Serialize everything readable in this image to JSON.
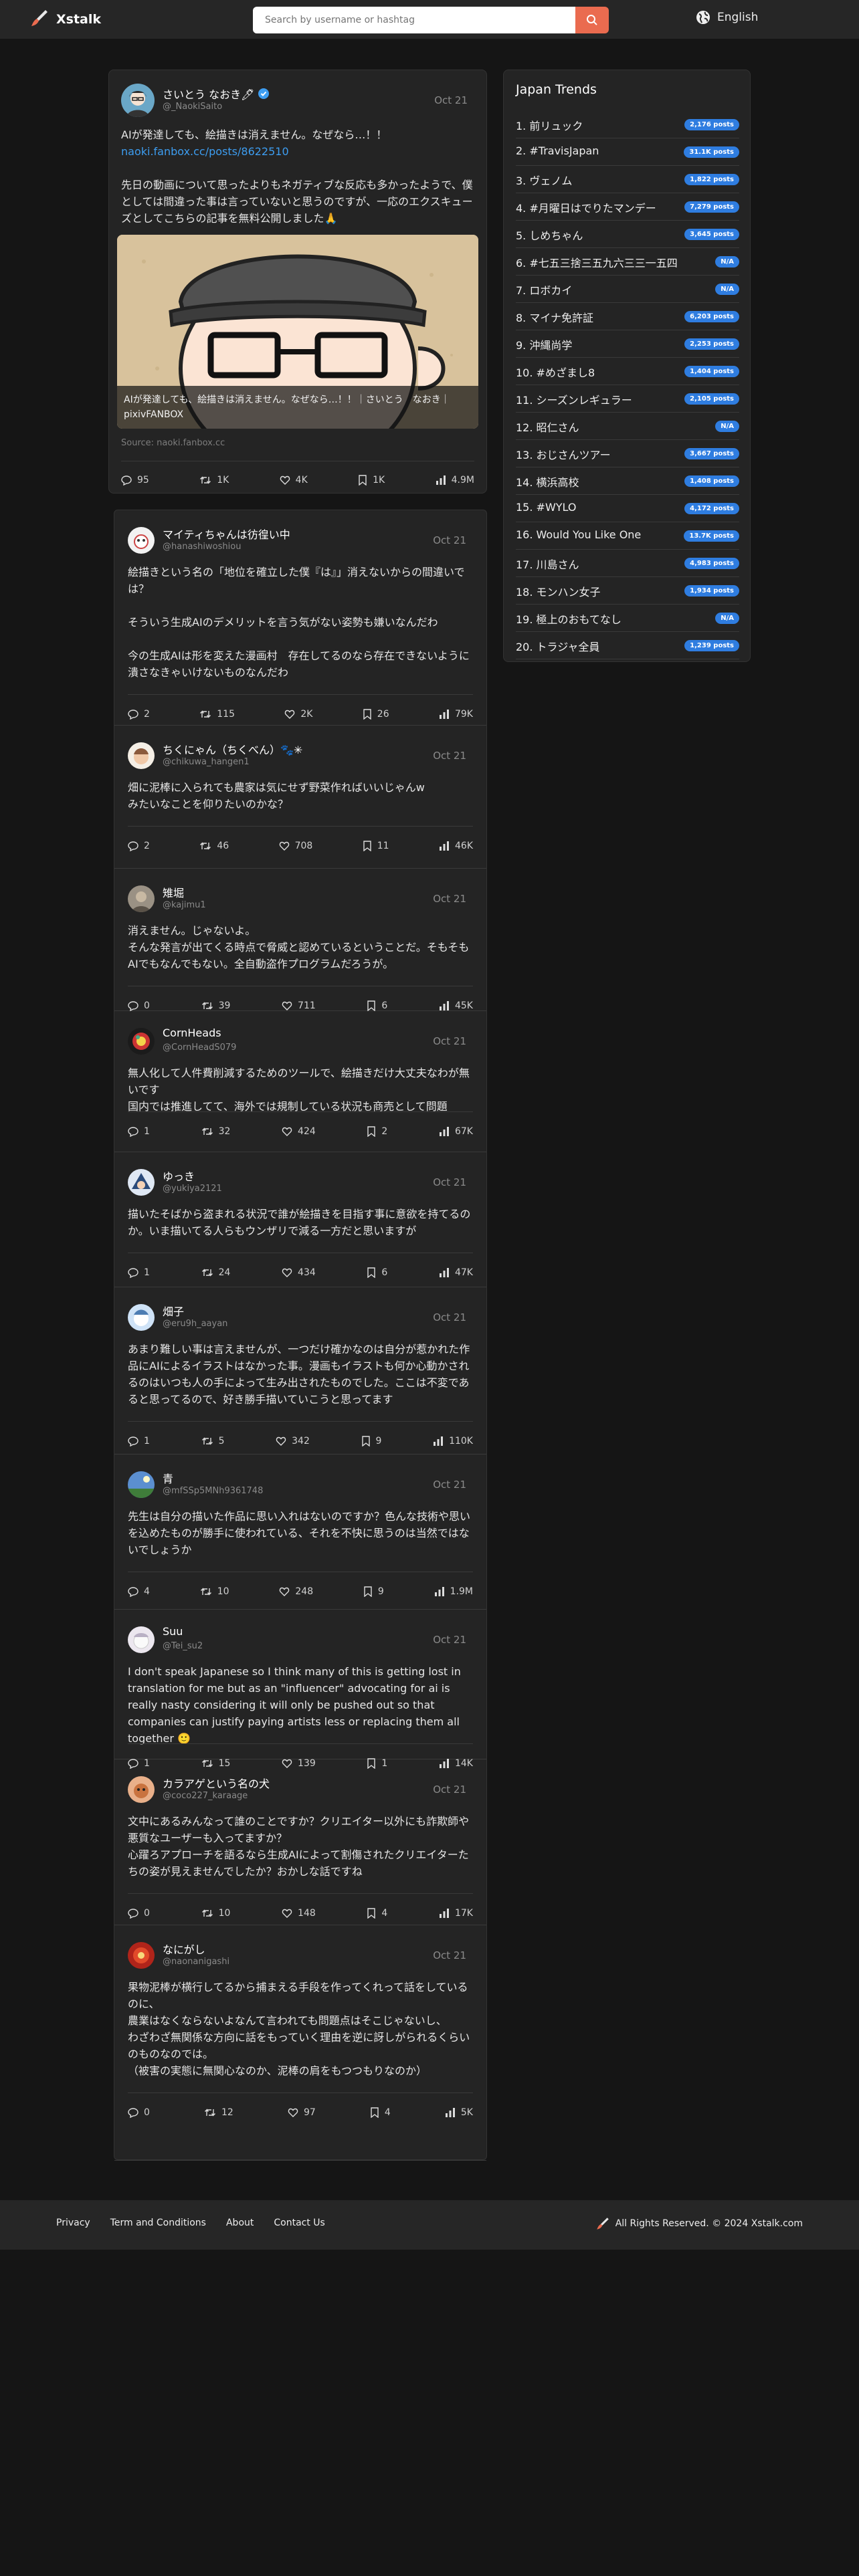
{
  "header": {
    "brand": "Xstalk",
    "search_placeholder": "Search by username or hashtag",
    "language": "English"
  },
  "main_post": {
    "username": "さいとう なおき🖊",
    "handle": "@_NaokiSaito",
    "date": "Oct 21",
    "text_line1": "AIが発達しても、絵描きは消えません。なぜなら…！！",
    "link": "naoki.fanbox.cc/posts/8622510",
    "text_line2": "先日の動画について思ったよりもネガティブな反応も多かったようで、僕としては間違った事は言っていないと思うのですが、一応のエクスキューズとしてこちらの記事を無料公開しました🙏",
    "card_caption": "AIが発達しても、絵描きは消えません。なぜなら…！！｜さいとう　なおき｜pixivFANBOX",
    "source": "Source: naoki.fanbox.cc",
    "stats": {
      "replies": "95",
      "reposts": "1K",
      "likes": "4K",
      "bookmarks": "1K",
      "views": "4.9M"
    }
  },
  "trends": {
    "title": "Japan Trends",
    "items": [
      {
        "rank": "1.",
        "name": "前リュック",
        "count": "2,176 posts"
      },
      {
        "rank": "2.",
        "name": "#TravisJapan",
        "count": "31.1K posts"
      },
      {
        "rank": "3.",
        "name": "ヴェノム",
        "count": "1,822 posts"
      },
      {
        "rank": "4.",
        "name": "#月曜日はでりたマンデー",
        "count": "7,279 posts"
      },
      {
        "rank": "5.",
        "name": "しめちゃん",
        "count": "3,645 posts"
      },
      {
        "rank": "6.",
        "name": "#七五三捨三五九六三三一五四",
        "count": "N/A"
      },
      {
        "rank": "7.",
        "name": "ロボカイ",
        "count": "N/A"
      },
      {
        "rank": "8.",
        "name": "マイナ免許証",
        "count": "6,203 posts"
      },
      {
        "rank": "9.",
        "name": "沖縄尚学",
        "count": "2,253 posts"
      },
      {
        "rank": "10.",
        "name": "#めざまし8",
        "count": "1,404 posts"
      },
      {
        "rank": "11.",
        "name": "シーズンレギュラー",
        "count": "2,105 posts"
      },
      {
        "rank": "12.",
        "name": "昭仁さん",
        "count": "N/A"
      },
      {
        "rank": "13.",
        "name": "おじさんツアー",
        "count": "3,667 posts"
      },
      {
        "rank": "14.",
        "name": "横浜高校",
        "count": "1,408 posts"
      },
      {
        "rank": "15.",
        "name": "#WYLO",
        "count": "4,172 posts"
      },
      {
        "rank": "16.",
        "name": "Would You Like One",
        "count": "13.7K posts"
      },
      {
        "rank": "17.",
        "name": "川島さん",
        "count": "4,983 posts"
      },
      {
        "rank": "18.",
        "name": "モンハン女子",
        "count": "1,934 posts"
      },
      {
        "rank": "19.",
        "name": "極上のおもてなし",
        "count": "N/A"
      },
      {
        "rank": "20.",
        "name": "トラジャ全員",
        "count": "1,239 posts"
      }
    ]
  },
  "replies": [
    {
      "username": "マイティちゃんは彷徨い中",
      "handle": "@hanashiwoshiou",
      "date": "Oct 21",
      "text": "絵描きという名の「地位を確立した僕『は』」消えないからの間違いでは？\n\nそういう生成AIのデメリットを言う気がない姿勢も嫌いなんだわ\n\n今の生成AIは形を変えた漫画村　存在してるのなら存在できないように潰さなきゃいけないものなんだわ",
      "stats": {
        "replies": "2",
        "reposts": "115",
        "likes": "2K",
        "bookmarks": "26",
        "views": "79K"
      }
    },
    {
      "username": "ちくにゃん（ちくべん）🐾✳",
      "handle": "@chikuwa_hangen1",
      "date": "Oct 21",
      "text": "畑に泥棒に入られても農家は気にせず野菜作ればいいじゃんw\nみたいなことを仰りたいのかな？",
      "stats": {
        "replies": "2",
        "reposts": "46",
        "likes": "708",
        "bookmarks": "11",
        "views": "46K"
      }
    },
    {
      "username": "雉堀",
      "handle": "@kajimu1",
      "date": "Oct 21",
      "text": "消えません。じゃないよ。\nそんな発言が出てくる時点で脅威と認めているということだ。そもそもAIでもなんでもない。全自動盗作プログラムだろうが。",
      "stats": {
        "replies": "0",
        "reposts": "39",
        "likes": "711",
        "bookmarks": "6",
        "views": "45K"
      }
    },
    {
      "username": "CornHeads",
      "handle": "@CornHeadS079",
      "date": "Oct 21",
      "text": "無人化して人件費削減するためのツールで、絵描きだけ大丈夫なわが無いです\n国内では推進してて、海外では規制している状況も商売として問題",
      "stats": {
        "replies": "1",
        "reposts": "32",
        "likes": "424",
        "bookmarks": "2",
        "views": "67K"
      }
    },
    {
      "username": "ゆっき",
      "handle": "@yukiya2121",
      "date": "Oct 21",
      "text": "描いたそばから盗まれる状況で誰が絵描きを目指す事に意欲を持てるのか。いま描いてる人らもウンザリで減る一方だと思いますが",
      "stats": {
        "replies": "1",
        "reposts": "24",
        "likes": "434",
        "bookmarks": "6",
        "views": "47K"
      }
    },
    {
      "username": "畑子",
      "handle": "@eru9h_aayan",
      "date": "Oct 21",
      "text": "あまり難しい事は言えませんが、一つだけ確かなのは自分が惹かれた作品にAIによるイラストはなかった事。漫画もイラストも何か心動かされるのはいつも人の手によって生み出されたものでした。ここは不変であると思ってるので、好き勝手描いていこうと思ってます",
      "stats": {
        "replies": "1",
        "reposts": "5",
        "likes": "342",
        "bookmarks": "9",
        "views": "110K"
      }
    },
    {
      "username": "青",
      "handle": "@mfSSp5MNh9361748",
      "date": "Oct 21",
      "text": "先生は自分の描いた作品に思い入れはないのですか？色んな技術や思いを込めたものが勝手に使われている、それを不快に思うのは当然ではないでしょうか",
      "stats": {
        "replies": "4",
        "reposts": "10",
        "likes": "248",
        "bookmarks": "9",
        "views": "1.9M"
      }
    },
    {
      "username": "Suu",
      "handle": "@Tei_su2",
      "date": "Oct 21",
      "text": "I don't speak Japanese so I think many of this is getting lost in translation for me but as an \"influencer\" advocating for ai is really nasty considering it will only be pushed out so that companies can justify paying artists less or replacing them all together 🙂",
      "stats": {
        "replies": "1",
        "reposts": "15",
        "likes": "139",
        "bookmarks": "1",
        "views": "14K"
      }
    },
    {
      "username": "カラアゲという名の犬",
      "handle": "@coco227_karaage",
      "date": "Oct 21",
      "text": "文中にあるみんなって誰のことですか？クリエイター以外にも詐欺師や悪質なユーザーも入ってますか？\n心躍ろアプローチを語るなら生成AIによって割傷されたクリエイターたちの姿が見えませんでしたか？おかしな話ですね",
      "stats": {
        "replies": "0",
        "reposts": "10",
        "likes": "148",
        "bookmarks": "4",
        "views": "17K"
      }
    },
    {
      "username": "なにがし",
      "handle": "@naonanigashi",
      "date": "Oct 21",
      "text": "果物泥棒が横行してるから捕まえる手段を作ってくれって話をしているのに、\n農業はなくならないよなんて言われても問題点はそこじゃないし、\nわざわざ無関係な方向に話をもっていく理由を逆に訝しがられるくらいのものなのでは。\n（被害の実態に無関心なのか、泥棒の肩をもつつもりなのか）",
      "stats": {
        "replies": "0",
        "reposts": "12",
        "likes": "97",
        "bookmarks": "4",
        "views": "5K"
      }
    }
  ],
  "footer": {
    "links": [
      "Privacy",
      "Term and Conditions",
      "About",
      "Contact Us"
    ],
    "copyright": "All Rights Reserved. © 2024 Xstalk.com"
  },
  "colors": {
    "accent": "#ea6b4f",
    "link": "#3d9df0",
    "badge": "#2f7de0",
    "panel": "#242424",
    "bg": "#151515"
  }
}
